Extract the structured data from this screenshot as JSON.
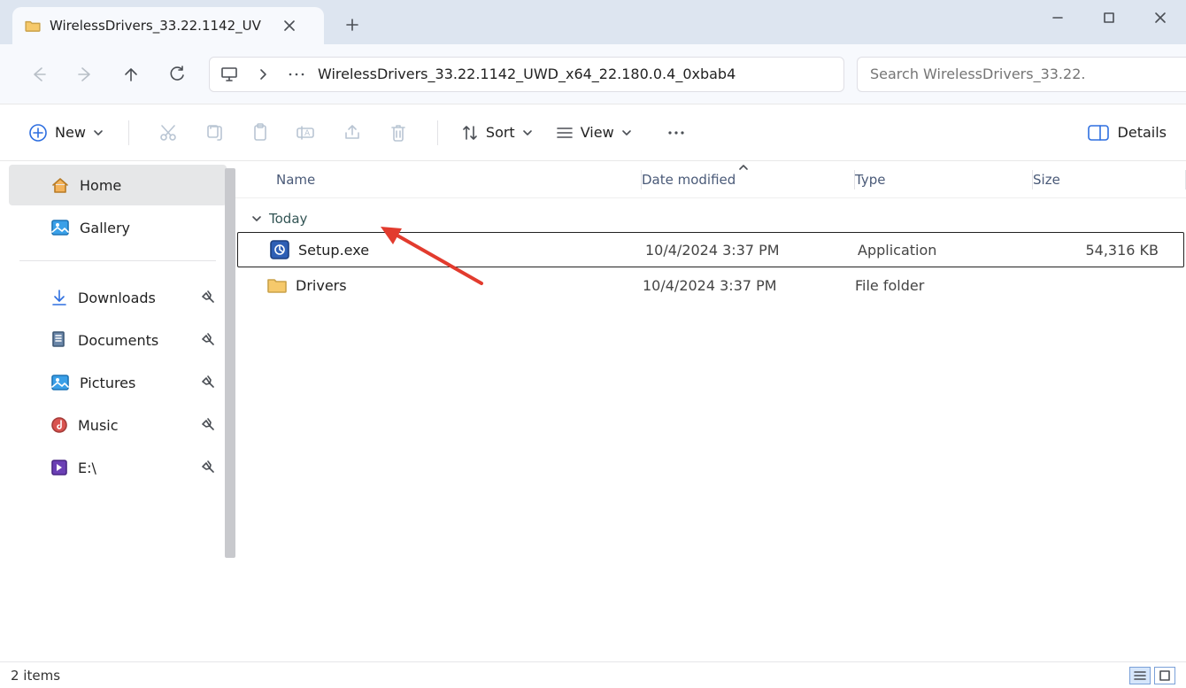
{
  "tab": {
    "title": "WirelessDrivers_33.22.1142_UV"
  },
  "address": {
    "path": "WirelessDrivers_33.22.1142_UWD_x64_22.180.0.4_0xbab4"
  },
  "search": {
    "placeholder": "Search WirelessDrivers_33.22."
  },
  "toolbar": {
    "new": "New",
    "sort": "Sort",
    "view": "View",
    "details": "Details"
  },
  "sidebar": {
    "items": [
      {
        "label": "Home"
      },
      {
        "label": "Gallery"
      },
      {
        "label": "Downloads"
      },
      {
        "label": "Documents"
      },
      {
        "label": "Pictures"
      },
      {
        "label": "Music"
      },
      {
        "label": "E:\\"
      }
    ]
  },
  "columns": {
    "name": "Name",
    "date": "Date modified",
    "type": "Type",
    "size": "Size"
  },
  "group": {
    "today": "Today"
  },
  "files": [
    {
      "name": "Setup.exe",
      "date": "10/4/2024 3:37 PM",
      "type": "Application",
      "size": "54,316 KB"
    },
    {
      "name": "Drivers",
      "date": "10/4/2024 3:37 PM",
      "type": "File folder",
      "size": ""
    }
  ],
  "status": {
    "count": "2 items"
  }
}
